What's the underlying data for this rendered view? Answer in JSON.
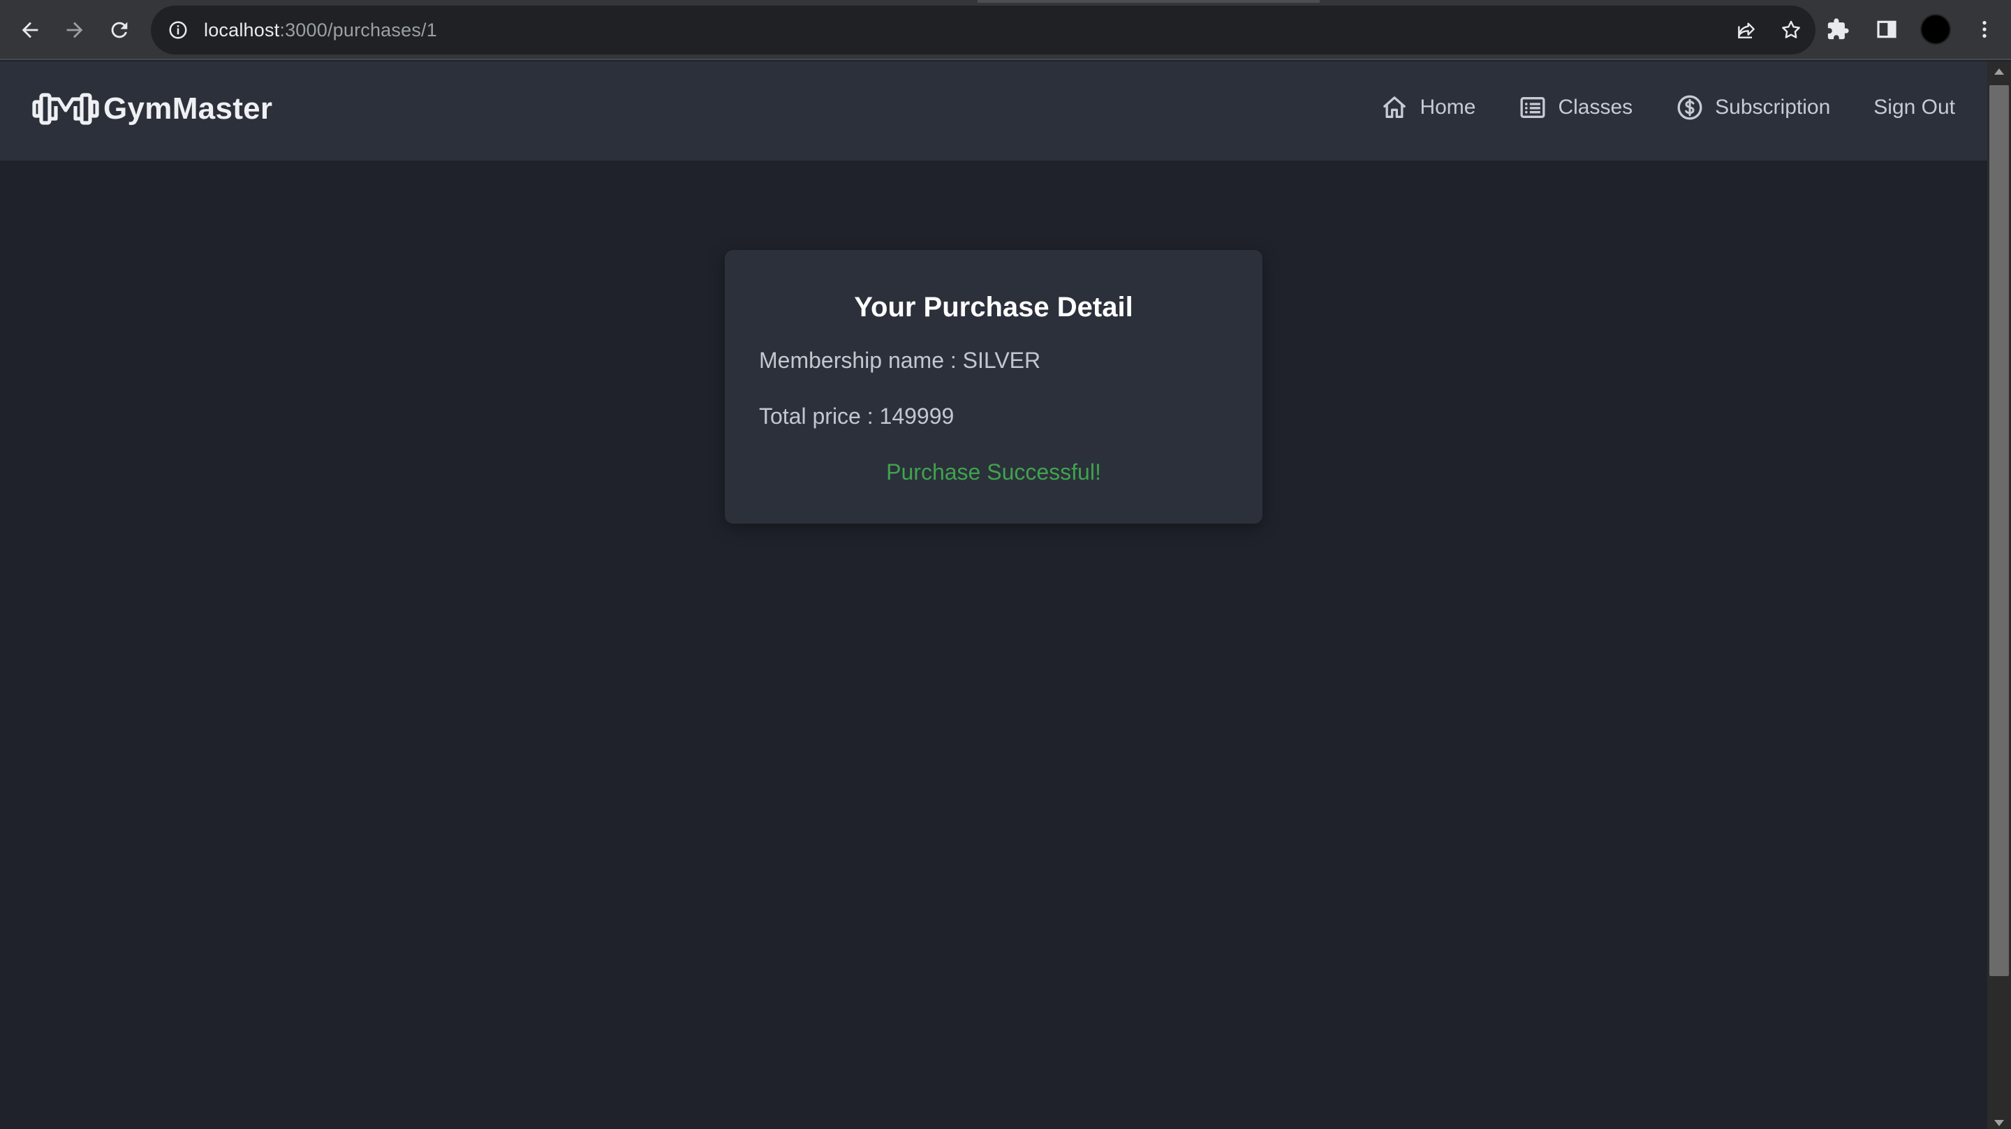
{
  "browser": {
    "url_host": "localhost",
    "url_path": ":3000/purchases/1"
  },
  "navbar": {
    "brand": "GymMaster",
    "links": [
      {
        "label": "Home",
        "icon": "home-icon"
      },
      {
        "label": "Classes",
        "icon": "list-icon"
      },
      {
        "label": "Subscription",
        "icon": "dollar-icon"
      },
      {
        "label": "Sign Out",
        "icon": ""
      }
    ]
  },
  "purchase": {
    "title": "Your Purchase Detail",
    "membership_line": "Membership name : SILVER",
    "price_line": "Total price : 149999",
    "status": "Purchase Successful!"
  },
  "colors": {
    "background": "#1f222b",
    "card": "#2c303b",
    "success": "#3fa34d"
  }
}
